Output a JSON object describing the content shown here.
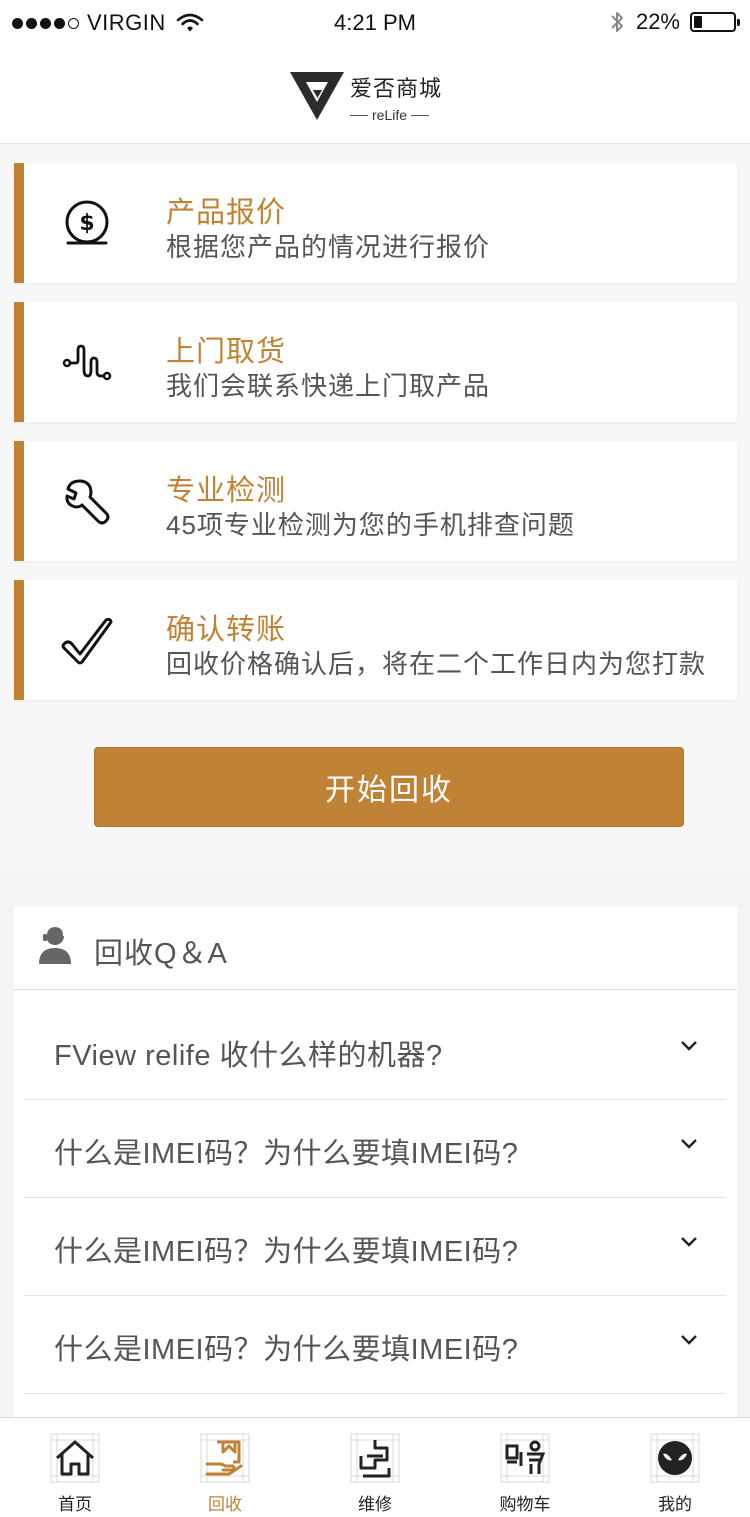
{
  "status_bar": {
    "carrier": "VIRGIN",
    "time": "4:21 PM",
    "battery_text": "22%",
    "battery_level": 0.22
  },
  "header": {
    "brand_cn": "爱否商城",
    "brand_en": "reLife"
  },
  "steps": [
    {
      "title": "产品报价",
      "desc": "根据您产品的情况进行报价",
      "icon": "dollar-coin-icon"
    },
    {
      "title": "上门取货",
      "desc": "我们会联系快递上门取产品",
      "icon": "route-icon"
    },
    {
      "title": "专业检测",
      "desc": "45项专业检测为您的手机排查问题",
      "icon": "wrench-icon"
    },
    {
      "title": "确认转账",
      "desc": "回收价格确认后，将在二个工作日内为您打款",
      "icon": "checkmark-icon"
    }
  ],
  "start_button": "开始回收",
  "qa": {
    "title": "回收Q＆A",
    "items": [
      {
        "question": "FView relife 收什么样的机器?"
      },
      {
        "question": "什么是IMEI码？为什么要填IMEI码?"
      },
      {
        "question": "什么是IMEI码？为什么要填IMEI码?"
      },
      {
        "question": "什么是IMEI码？为什么要填IMEI码?"
      }
    ]
  },
  "tabs": [
    {
      "label": "首页",
      "icon": "home-icon",
      "active": false
    },
    {
      "label": "回收",
      "icon": "recycle-icon",
      "active": true
    },
    {
      "label": "维修",
      "icon": "repair-icon",
      "active": false
    },
    {
      "label": "购物车",
      "icon": "cart-icon",
      "active": false
    },
    {
      "label": "我的",
      "icon": "alien-profile-icon",
      "active": false
    }
  ],
  "colors": {
    "accent": "#c08235",
    "text_gray": "#555555",
    "background": "#f4f4f4"
  }
}
